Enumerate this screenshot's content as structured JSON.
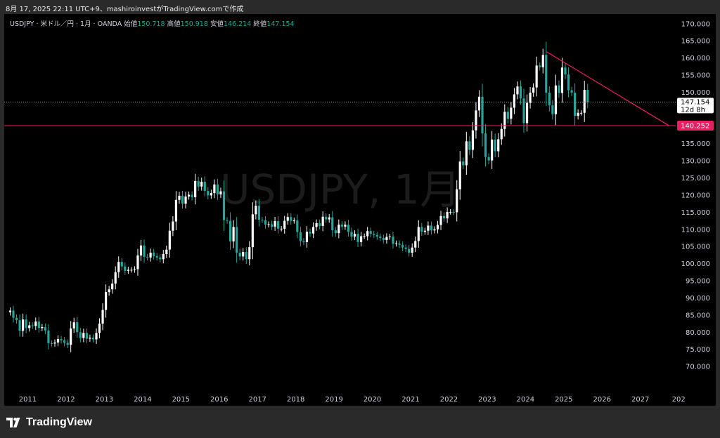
{
  "header": {
    "caption": "8月 17, 2025 22:11 UTC+9、mashiroinvestがTradingView.comで作成"
  },
  "legend": {
    "symbol": "USDJPY · 米ドル／円 · 1月 · OANDA",
    "open_label": "始値",
    "open": "150.718",
    "high_label": "高値",
    "high": "150.918",
    "low_label": "安値",
    "low": "146.214",
    "close_label": "終値",
    "close": "147.154"
  },
  "watermark": "USDJPY, 1月",
  "footer": {
    "brand": "TradingView"
  },
  "colors": {
    "up": "#ffffff",
    "down": "#26a69a",
    "level_line": "#e91e63",
    "trend_line": "#e91e63",
    "background": "#000000"
  },
  "chart_data": {
    "type": "candlestick",
    "title": "USDJPY, 1月",
    "interval": "monthly",
    "x_ticks": [
      "2011",
      "2012",
      "2013",
      "2014",
      "2015",
      "2016",
      "2017",
      "2018",
      "2019",
      "2020",
      "2021",
      "2022",
      "2023",
      "2024",
      "2025",
      "2026",
      "2027",
      "202"
    ],
    "y_ticks": [
      "70.000",
      "75.000",
      "80.000",
      "85.000",
      "90.000",
      "95.000",
      "100.000",
      "105.000",
      "110.000",
      "115.000",
      "120.000",
      "125.000",
      "130.000",
      "135.000",
      "140.000",
      "145.000",
      "150.000",
      "155.000",
      "160.000",
      "165.000",
      "170.000"
    ],
    "ylim": [
      67.4,
      172.6
    ],
    "last_price": {
      "value": "147.154",
      "countdown": "12d 8h"
    },
    "horizontal_level": {
      "value": "140.252"
    },
    "trendline": {
      "from": {
        "date": "2024-07",
        "price": 161.9
      },
      "to": {
        "date": "2027-10",
        "price": 140.25
      }
    },
    "monthly_close": [
      [
        "2010-07",
        86.3
      ],
      [
        "2010-08",
        84.2
      ],
      [
        "2010-09",
        83.5
      ],
      [
        "2010-10",
        80.4
      ],
      [
        "2010-11",
        83.7
      ],
      [
        "2010-12",
        81.2
      ],
      [
        "2011-01",
        82.0
      ],
      [
        "2011-02",
        81.8
      ],
      [
        "2011-03",
        83.1
      ],
      [
        "2011-04",
        81.2
      ],
      [
        "2011-05",
        81.5
      ],
      [
        "2011-06",
        80.5
      ],
      [
        "2011-07",
        76.8
      ],
      [
        "2011-08",
        76.7
      ],
      [
        "2011-09",
        77.0
      ],
      [
        "2011-10",
        78.0
      ],
      [
        "2011-11",
        77.6
      ],
      [
        "2011-12",
        76.9
      ],
      [
        "2012-01",
        76.3
      ],
      [
        "2012-02",
        81.1
      ],
      [
        "2012-03",
        82.9
      ],
      [
        "2012-04",
        80.0
      ],
      [
        "2012-05",
        78.3
      ],
      [
        "2012-06",
        79.8
      ],
      [
        "2012-07",
        78.1
      ],
      [
        "2012-08",
        78.4
      ],
      [
        "2012-09",
        77.9
      ],
      [
        "2012-10",
        79.8
      ],
      [
        "2012-11",
        82.5
      ],
      [
        "2012-12",
        86.5
      ],
      [
        "2013-01",
        91.7
      ],
      [
        "2013-02",
        92.5
      ],
      [
        "2013-03",
        94.2
      ],
      [
        "2013-04",
        97.5
      ],
      [
        "2013-05",
        100.5
      ],
      [
        "2013-06",
        99.2
      ],
      [
        "2013-07",
        97.9
      ],
      [
        "2013-08",
        98.2
      ],
      [
        "2013-09",
        98.2
      ],
      [
        "2013-10",
        98.4
      ],
      [
        "2013-11",
        102.4
      ],
      [
        "2013-12",
        105.3
      ],
      [
        "2014-01",
        102.0
      ],
      [
        "2014-02",
        101.8
      ],
      [
        "2014-03",
        103.2
      ],
      [
        "2014-04",
        102.2
      ],
      [
        "2014-05",
        101.8
      ],
      [
        "2014-06",
        101.3
      ],
      [
        "2014-07",
        102.8
      ],
      [
        "2014-08",
        104.1
      ],
      [
        "2014-09",
        109.6
      ],
      [
        "2014-10",
        112.3
      ],
      [
        "2014-11",
        118.6
      ],
      [
        "2014-12",
        119.8
      ],
      [
        "2015-01",
        117.5
      ],
      [
        "2015-02",
        119.6
      ],
      [
        "2015-03",
        120.1
      ],
      [
        "2015-04",
        119.4
      ],
      [
        "2015-05",
        124.1
      ],
      [
        "2015-06",
        122.5
      ],
      [
        "2015-07",
        123.9
      ],
      [
        "2015-08",
        121.2
      ],
      [
        "2015-09",
        119.9
      ],
      [
        "2015-10",
        120.6
      ],
      [
        "2015-11",
        123.1
      ],
      [
        "2015-12",
        120.2
      ],
      [
        "2016-01",
        121.1
      ],
      [
        "2016-02",
        112.7
      ],
      [
        "2016-03",
        112.5
      ],
      [
        "2016-04",
        106.5
      ],
      [
        "2016-05",
        110.7
      ],
      [
        "2016-06",
        103.2
      ],
      [
        "2016-07",
        102.1
      ],
      [
        "2016-08",
        103.4
      ],
      [
        "2016-09",
        101.3
      ],
      [
        "2016-10",
        104.8
      ],
      [
        "2016-11",
        114.4
      ],
      [
        "2016-12",
        116.9
      ],
      [
        "2017-01",
        112.8
      ],
      [
        "2017-02",
        112.7
      ],
      [
        "2017-03",
        111.4
      ],
      [
        "2017-04",
        111.5
      ],
      [
        "2017-05",
        110.8
      ],
      [
        "2017-06",
        112.4
      ],
      [
        "2017-07",
        110.2
      ],
      [
        "2017-08",
        110.2
      ],
      [
        "2017-09",
        112.5
      ],
      [
        "2017-10",
        113.6
      ],
      [
        "2017-11",
        112.5
      ],
      [
        "2017-12",
        112.6
      ],
      [
        "2018-01",
        109.2
      ],
      [
        "2018-02",
        106.6
      ],
      [
        "2018-03",
        106.3
      ],
      [
        "2018-04",
        109.3
      ],
      [
        "2018-05",
        108.8
      ],
      [
        "2018-06",
        110.7
      ],
      [
        "2018-07",
        111.8
      ],
      [
        "2018-08",
        111.0
      ],
      [
        "2018-09",
        113.7
      ],
      [
        "2018-10",
        112.9
      ],
      [
        "2018-11",
        113.5
      ],
      [
        "2018-12",
        109.7
      ],
      [
        "2019-01",
        108.9
      ],
      [
        "2019-02",
        111.4
      ],
      [
        "2019-03",
        110.8
      ],
      [
        "2019-04",
        111.4
      ],
      [
        "2019-05",
        109.3
      ],
      [
        "2019-06",
        107.9
      ],
      [
        "2019-07",
        108.7
      ],
      [
        "2019-08",
        106.3
      ],
      [
        "2019-09",
        108.0
      ],
      [
        "2019-10",
        108.0
      ],
      [
        "2019-11",
        109.5
      ],
      [
        "2019-12",
        108.7
      ],
      [
        "2020-01",
        108.4
      ],
      [
        "2020-02",
        107.9
      ],
      [
        "2020-03",
        107.5
      ],
      [
        "2020-04",
        106.9
      ],
      [
        "2020-05",
        107.8
      ],
      [
        "2020-06",
        107.9
      ],
      [
        "2020-07",
        105.8
      ],
      [
        "2020-08",
        105.9
      ],
      [
        "2020-09",
        105.5
      ],
      [
        "2020-10",
        104.7
      ],
      [
        "2020-11",
        104.3
      ],
      [
        "2020-12",
        103.2
      ],
      [
        "2021-01",
        104.7
      ],
      [
        "2021-02",
        106.6
      ],
      [
        "2021-03",
        110.7
      ],
      [
        "2021-04",
        109.3
      ],
      [
        "2021-05",
        109.6
      ],
      [
        "2021-06",
        111.1
      ],
      [
        "2021-07",
        109.7
      ],
      [
        "2021-08",
        110.0
      ],
      [
        "2021-09",
        111.3
      ],
      [
        "2021-10",
        113.9
      ],
      [
        "2021-11",
        113.2
      ],
      [
        "2021-12",
        115.1
      ],
      [
        "2022-01",
        115.1
      ],
      [
        "2022-02",
        115.0
      ],
      [
        "2022-03",
        121.7
      ],
      [
        "2022-04",
        129.8
      ],
      [
        "2022-05",
        128.7
      ],
      [
        "2022-06",
        135.7
      ],
      [
        "2022-07",
        133.2
      ],
      [
        "2022-08",
        138.9
      ],
      [
        "2022-09",
        144.7
      ],
      [
        "2022-10",
        148.7
      ],
      [
        "2022-11",
        138.0
      ],
      [
        "2022-12",
        131.1
      ],
      [
        "2023-01",
        130.1
      ],
      [
        "2023-02",
        136.2
      ],
      [
        "2023-03",
        132.8
      ],
      [
        "2023-04",
        136.3
      ],
      [
        "2023-05",
        139.3
      ],
      [
        "2023-06",
        144.3
      ],
      [
        "2023-07",
        142.3
      ],
      [
        "2023-08",
        145.5
      ],
      [
        "2023-09",
        149.4
      ],
      [
        "2023-10",
        151.7
      ],
      [
        "2023-11",
        148.2
      ],
      [
        "2023-12",
        141.0
      ],
      [
        "2024-01",
        146.9
      ],
      [
        "2024-02",
        149.9
      ],
      [
        "2024-03",
        151.4
      ],
      [
        "2024-04",
        157.8
      ],
      [
        "2024-05",
        157.3
      ],
      [
        "2024-06",
        160.9
      ],
      [
        "2024-07",
        149.9
      ],
      [
        "2024-08",
        146.2
      ],
      [
        "2024-09",
        143.6
      ],
      [
        "2024-10",
        152.0
      ],
      [
        "2024-11",
        149.8
      ],
      [
        "2024-12",
        157.2
      ],
      [
        "2025-01",
        155.2
      ],
      [
        "2025-02",
        150.6
      ],
      [
        "2025-03",
        149.9
      ],
      [
        "2025-04",
        143.1
      ],
      [
        "2025-05",
        144.0
      ],
      [
        "2025-06",
        144.0
      ],
      [
        "2025-07",
        150.7
      ],
      [
        "2025-08",
        147.154
      ]
    ]
  }
}
